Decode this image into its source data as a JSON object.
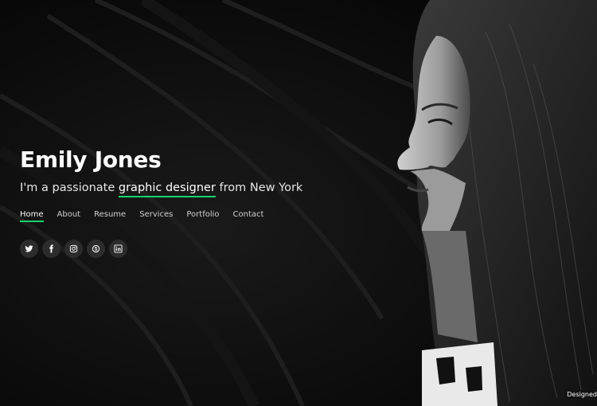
{
  "hero": {
    "name": "Emily Jones",
    "tagline_prefix": "I'm a passionate ",
    "tagline_typed": "graphic designer",
    "tagline_suffix": " from New York",
    "accent_color": "#18d26e"
  },
  "nav": {
    "items": [
      {
        "label": "Home",
        "active": true
      },
      {
        "label": "About",
        "active": false
      },
      {
        "label": "Resume",
        "active": false
      },
      {
        "label": "Services",
        "active": false
      },
      {
        "label": "Portfolio",
        "active": false
      },
      {
        "label": "Contact",
        "active": false
      }
    ]
  },
  "social": {
    "icons": [
      "twitter-icon",
      "facebook-icon",
      "instagram-icon",
      "skype-icon",
      "linkedin-icon"
    ]
  },
  "footer": {
    "credit": "Designed"
  }
}
